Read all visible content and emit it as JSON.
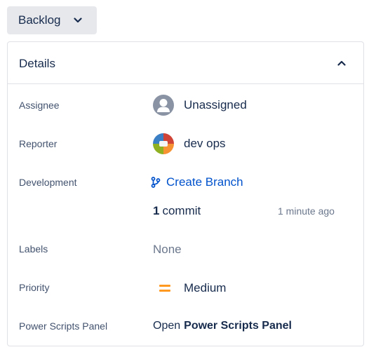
{
  "status": {
    "label": "Backlog"
  },
  "details": {
    "title": "Details",
    "fields": {
      "assignee": {
        "label": "Assignee",
        "value": "Unassigned"
      },
      "reporter": {
        "label": "Reporter",
        "value": "dev ops"
      },
      "development": {
        "label": "Development",
        "create_branch": "Create Branch",
        "commit_count": "1",
        "commit_word": "commit",
        "commit_time": "1 minute ago"
      },
      "labels": {
        "label": "Labels",
        "value": "None"
      },
      "priority": {
        "label": "Priority",
        "value": "Medium",
        "color": "#ff991f"
      },
      "power_scripts": {
        "label": "Power Scripts Panel",
        "prefix": "Open",
        "link": "Power Scripts Panel"
      }
    }
  },
  "colors": {
    "link": "#0052cc",
    "text": "#172b4d",
    "label": "#42526e",
    "border": "#dfe1e6",
    "status_bg": "#e6e8ec"
  },
  "icons": {
    "status_chevron": "chevron-down-icon",
    "collapse": "chevron-up-icon",
    "branch": "branch-icon",
    "priority": "priority-medium-icon"
  }
}
